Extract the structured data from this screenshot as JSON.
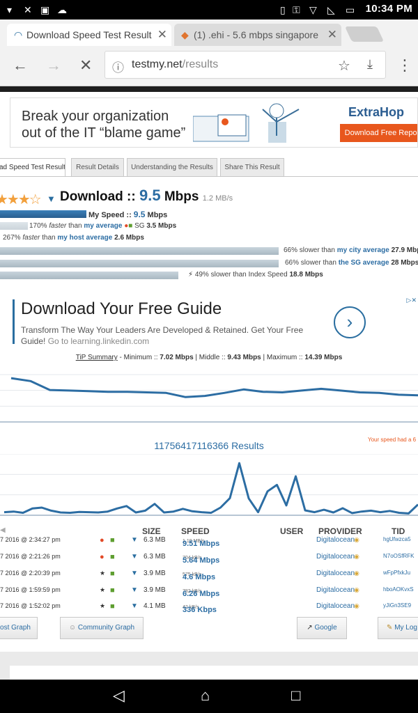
{
  "status_bar": {
    "time": "10:34 PM"
  },
  "tabs": [
    {
      "title": "Download Speed Test Result",
      "active": true
    },
    {
      "title": "(1) .ehi - 5.6 mbps singapore",
      "active": false
    }
  ],
  "toolbar": {
    "url_host": "testmy.net",
    "url_path": "/results"
  },
  "ad1": {
    "headline_1": "Break your organization",
    "headline_2": "out of the IT “blame game”",
    "logo": "ExtraHop",
    "cta": "Download Free Report"
  },
  "nav_tabs": [
    "ad Speed Test Result",
    "Result Details",
    "Understanding the Results",
    "Share This Result"
  ],
  "result": {
    "label": "Download ::",
    "value": "9.5",
    "unit": "Mbps",
    "mbs": "1.2 MB/s",
    "my_speed_label": "My Speed ::",
    "my_speed_value": "9.5",
    "my_speed_unit": "Mbps",
    "r1_pct": "170%",
    "r1_word": "faster",
    "r1_than": "than",
    "r1_link": "my average",
    "r1_loc": "SG",
    "r1_val": "3.5 Mbps",
    "r2_pct": "267%",
    "r2_word": "faster",
    "r2_than": "than",
    "r2_link": "my host average",
    "r2_val": "2.6 Mbps",
    "r3_text": "66% slower than",
    "r3_link": "my city average",
    "r3_val": "27.9 Mbps",
    "r4_text": "66% slower than",
    "r4_link": "the SG average",
    "r4_val": "28 Mbps",
    "r5_text": "49% slower than Index Speed",
    "r5_val": "18.8 Mbps"
  },
  "ad2": {
    "headline": "Download Your Free Guide",
    "desc": "Transform The Way Your Leaders Are Developed & Retained. Get Your Free Guide!",
    "link": "Go to learning.linkedin.com"
  },
  "tip": {
    "label": "TiP Summary",
    "min_label": " - Minimum :: ",
    "min": "7.02 Mbps",
    "mid_label": " | Middle :: ",
    "mid": "9.43 Mbps",
    "max_label": " | Maximum :: ",
    "max": "14.39 Mbps"
  },
  "results_count": "11756417116366 Results",
  "speed_note": "Your speed had a 6",
  "table": {
    "headers": {
      "size": "SIZE",
      "speed": "SPEED",
      "user": "USER",
      "provider": "PROVIDER",
      "tid": "TID"
    },
    "rows": [
      {
        "date": "7 2016 @ 2:34:27 pm",
        "size": "6.3 MB",
        "speed": "9.51 Mbps",
        "mbs": "1.19 MB/s",
        "provider": "Digitalocean",
        "tid": "hgUfwzca5"
      },
      {
        "date": "7 2016 @ 2:21:26 pm",
        "size": "6.3 MB",
        "speed": "5.64 Mbps",
        "mbs": "704 kB/s",
        "provider": "Digitalocean",
        "tid": "N7oOSfRFK"
      },
      {
        "date": "7 2016 @ 2:20:39 pm",
        "size": "3.9 MB",
        "speed": "4.6 Mbps",
        "mbs": "575 kB/s",
        "provider": "Digitalocean",
        "tid": "wFpPfxkJu"
      },
      {
        "date": "7 2016 @ 1:59:59 pm",
        "size": "3.9 MB",
        "speed": "6.26 Mbps",
        "mbs": "782 kB/s",
        "provider": "Digitalocean",
        "tid": "hboAOKvxS"
      },
      {
        "date": "7 2016 @ 1:52:02 pm",
        "size": "4.1 MB",
        "speed": "336 Kbps",
        "mbs": "42 kB/s",
        "provider": "Digitalocean",
        "tid": "yJiGn3SE9"
      }
    ]
  },
  "buttons": {
    "host_graph": "ost Graph",
    "community_graph": "Community Graph",
    "google": "Google",
    "my_log": "My Log"
  },
  "chart_data": [
    {
      "type": "line",
      "title": "",
      "x": [
        0,
        1,
        2,
        3,
        4,
        5,
        6,
        7,
        8,
        9,
        10,
        11,
        12,
        13,
        14,
        15,
        16,
        17,
        18,
        19,
        20,
        21
      ],
      "values": [
        14.4,
        13.9,
        12.4,
        12.3,
        12.2,
        12.1,
        12.1,
        12.0,
        11.9,
        11.2,
        11.4,
        11.9,
        12.5,
        12.1,
        12.0,
        12.3,
        12.6,
        12.3,
        12.0,
        11.9,
        11.6,
        11.5
      ],
      "ylim": [
        7,
        15
      ],
      "grid": true
    },
    {
      "type": "line",
      "title": "",
      "x": [
        0,
        1,
        2,
        3,
        4,
        5,
        6,
        7,
        8,
        9,
        10,
        11,
        12,
        13,
        14,
        15,
        16,
        17,
        18,
        19,
        20,
        21,
        22,
        23,
        24,
        25,
        26,
        27,
        28,
        29,
        30,
        31,
        32,
        33,
        34,
        35,
        36,
        37,
        38,
        39,
        40,
        41,
        42,
        43,
        44
      ],
      "values": [
        1,
        1.2,
        0.8,
        2.2,
        2.5,
        1.5,
        0.9,
        0.8,
        1.1,
        1.0,
        0.9,
        1.2,
        2.2,
        3.0,
        0.9,
        1.5,
        3.7,
        0.9,
        1.2,
        2.1,
        1.3,
        1.0,
        0.8,
        2.5,
        5.6,
        17,
        5.5,
        1.0,
        7.8,
        9.9,
        3.2,
        12.7,
        1.6,
        1.0,
        1.8,
        0.9,
        2.3,
        0.7,
        1.2,
        1.5,
        1.0,
        1.4,
        0.8,
        0.6,
        3.5
      ],
      "ylim": [
        0,
        20
      ],
      "grid": true
    }
  ]
}
